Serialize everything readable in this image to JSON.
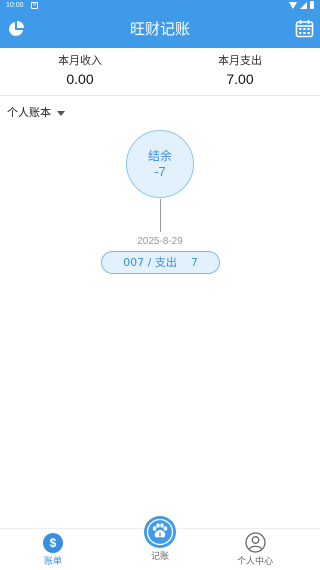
{
  "status_bar": {
    "time": "10:00"
  },
  "app": {
    "title": "旺财记账"
  },
  "icons": {
    "left": "pie-chart-icon",
    "right": "calendar-icon"
  },
  "summary": {
    "income_label": "本月收入",
    "income_value": "0.00",
    "expense_label": "本月支出",
    "expense_value": "7.00"
  },
  "book": {
    "label": "个人账本"
  },
  "balance": {
    "label": "结余",
    "value": "-7"
  },
  "record": {
    "date": "2025-8-29",
    "detail": "007 / 支出    7"
  },
  "nav": {
    "bill": "账单",
    "add": "记账",
    "me": "个人中心"
  },
  "colors": {
    "primary": "#3f9bea",
    "accent": "#3a8fe0",
    "light": "#e3f1fd"
  }
}
